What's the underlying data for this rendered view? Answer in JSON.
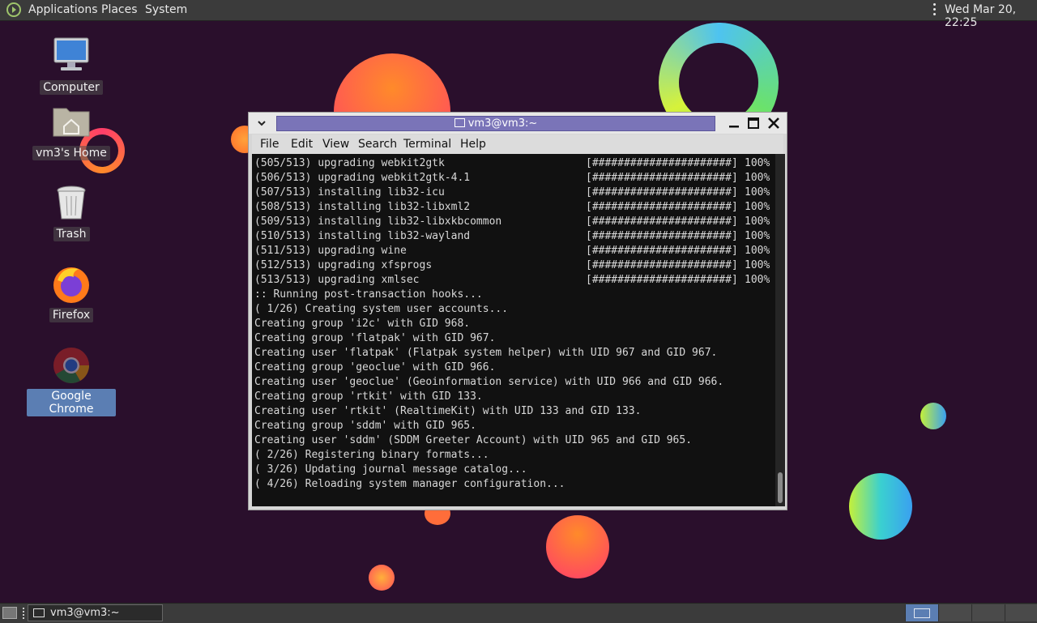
{
  "top_panel": {
    "menus": [
      "Applications",
      "Places",
      "System"
    ],
    "clock": "Wed Mar 20, 22:25"
  },
  "desktop": {
    "icons": [
      {
        "label": "Computer",
        "icon": "computer-icon",
        "selected": false
      },
      {
        "label": "vm3's Home",
        "icon": "home-folder-icon",
        "selected": false
      },
      {
        "label": "Trash",
        "icon": "trash-icon",
        "selected": false
      },
      {
        "label": "Firefox",
        "icon": "firefox-icon",
        "selected": false
      },
      {
        "label": "Google Chrome",
        "icon": "chrome-icon",
        "selected": true
      }
    ]
  },
  "terminal": {
    "title": "vm3@vm3:~",
    "menu": [
      "File",
      "Edit",
      "View",
      "Search",
      "Terminal",
      "Help"
    ],
    "progress_lines": [
      {
        "step": "(505/513)",
        "action": "upgrading",
        "package": "webkit2gtk",
        "bar": "[######################]",
        "percent": "100%"
      },
      {
        "step": "(506/513)",
        "action": "upgrading",
        "package": "webkit2gtk-4.1",
        "bar": "[######################]",
        "percent": "100%"
      },
      {
        "step": "(507/513)",
        "action": "installing",
        "package": "lib32-icu",
        "bar": "[######################]",
        "percent": "100%"
      },
      {
        "step": "(508/513)",
        "action": "installing",
        "package": "lib32-libxml2",
        "bar": "[######################]",
        "percent": "100%"
      },
      {
        "step": "(509/513)",
        "action": "installing",
        "package": "lib32-libxkbcommon",
        "bar": "[######################]",
        "percent": "100%"
      },
      {
        "step": "(510/513)",
        "action": "installing",
        "package": "lib32-wayland",
        "bar": "[######################]",
        "percent": "100%"
      },
      {
        "step": "(511/513)",
        "action": "upgrading",
        "package": "wine",
        "bar": "[######################]",
        "percent": "100%"
      },
      {
        "step": "(512/513)",
        "action": "upgrading",
        "package": "xfsprogs",
        "bar": "[######################]",
        "percent": "100%"
      },
      {
        "step": "(513/513)",
        "action": "upgrading",
        "package": "xmlsec",
        "bar": "[######################]",
        "percent": "100%"
      }
    ],
    "log_lines": [
      ":: Running post-transaction hooks...",
      "( 1/26) Creating system user accounts...",
      "Creating group 'i2c' with GID 968.",
      "Creating group 'flatpak' with GID 967.",
      "Creating user 'flatpak' (Flatpak system helper) with UID 967 and GID 967.",
      "Creating group 'geoclue' with GID 966.",
      "Creating user 'geoclue' (Geoinformation service) with UID 966 and GID 966.",
      "Creating group 'rtkit' with GID 133.",
      "Creating user 'rtkit' (RealtimeKit) with UID 133 and GID 133.",
      "Creating group 'sddm' with GID 965.",
      "Creating user 'sddm' (SDDM Greeter Account) with UID 965 and GID 965.",
      "( 2/26) Registering binary formats...",
      "( 3/26) Updating journal message catalog...",
      "( 4/26) Reloading system manager configuration..."
    ]
  },
  "bottom_panel": {
    "taskbar_items": [
      {
        "label": "vm3@vm3:~",
        "icon": "terminal-icon"
      }
    ],
    "workspaces": 4,
    "active_workspace": 1
  }
}
